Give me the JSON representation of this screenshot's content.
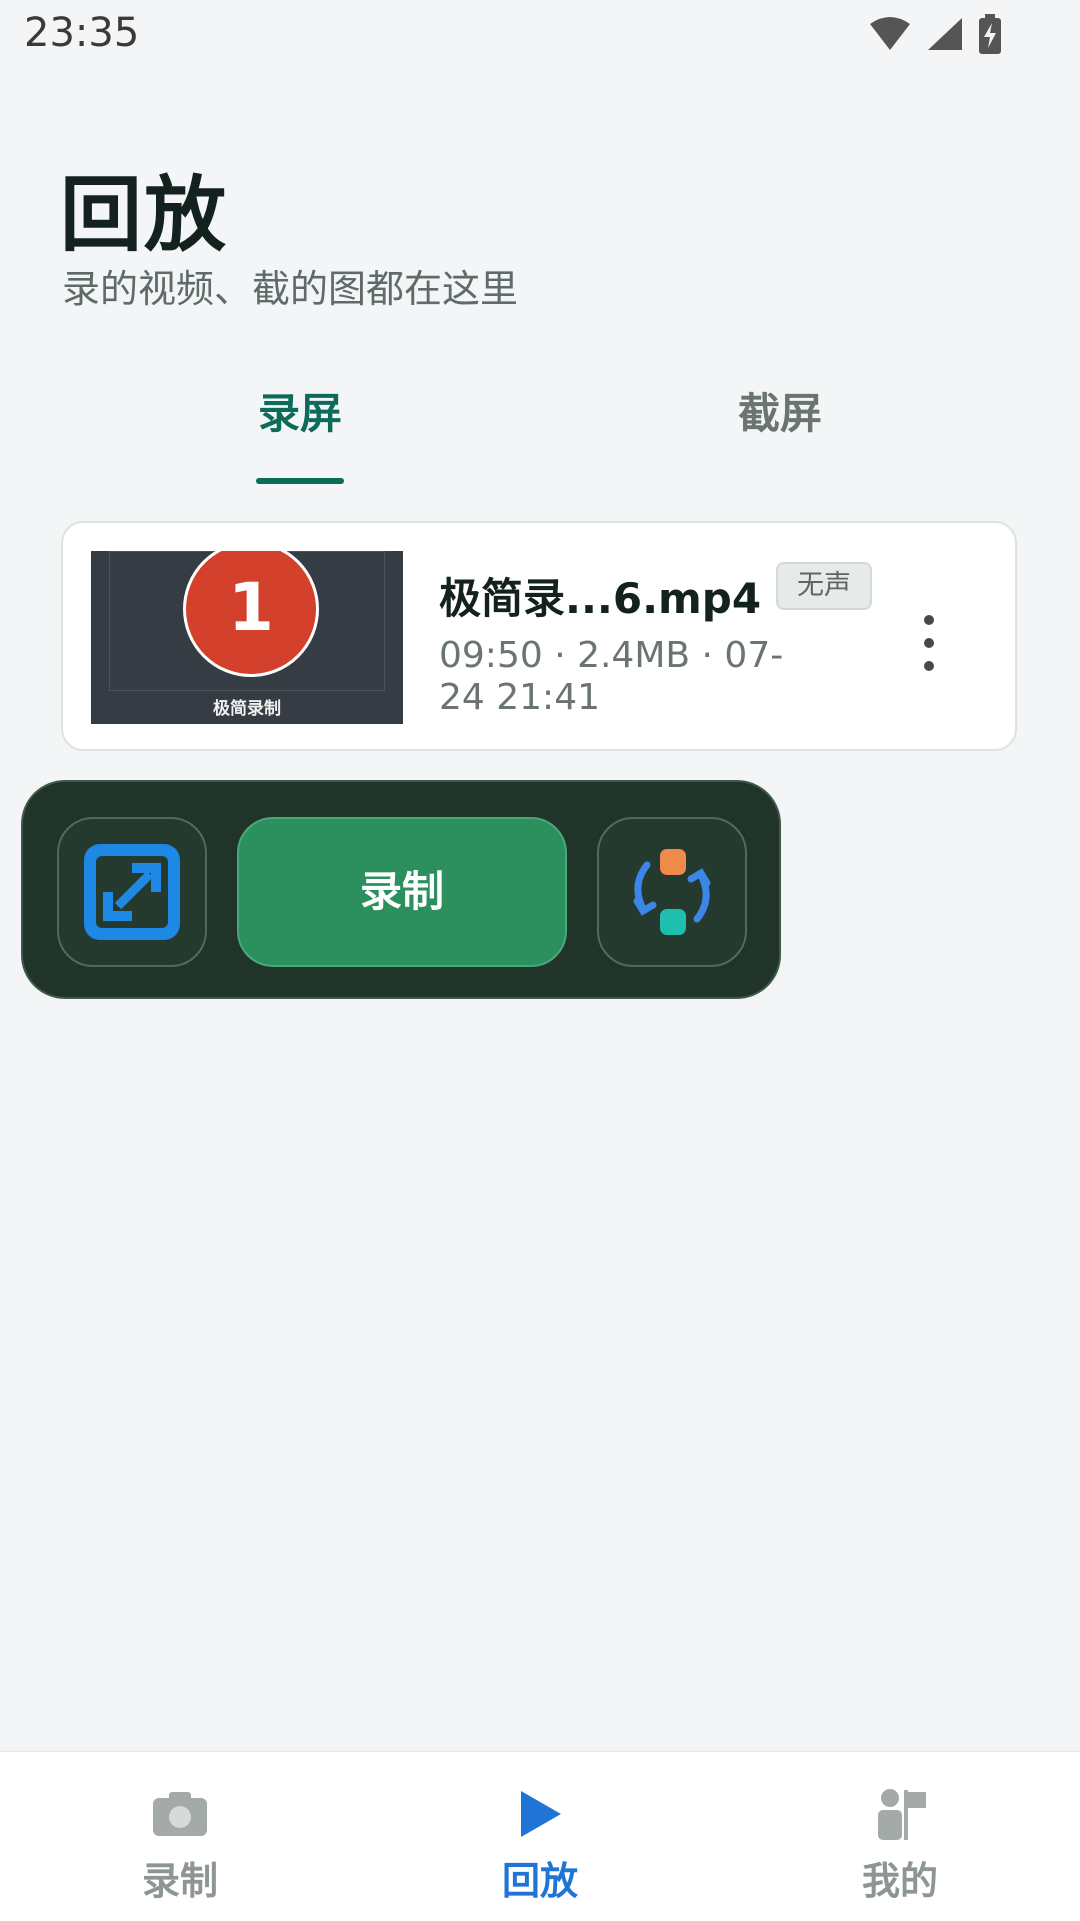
{
  "status_bar": {
    "time": "23:35"
  },
  "header": {
    "title": "回放",
    "subtitle": "录的视频、截的图都在这里"
  },
  "tabs": [
    {
      "label": "录屏",
      "selected": true
    },
    {
      "label": "截屏",
      "selected": false
    }
  ],
  "recordings": [
    {
      "thumbnail_number": "1",
      "thumbnail_caption": "极简录制",
      "name": "极简录...6.mp4",
      "badge": "无声",
      "meta": "09:50 · 2.4MB · 07-24 21:41"
    }
  ],
  "floating_toolbar": {
    "record_label": "录制",
    "region_icon": "expand-frame-icon",
    "switch_icon": "switch-mode-icon"
  },
  "bottom_nav": [
    {
      "label": "录制",
      "icon": "camera-icon",
      "selected": false
    },
    {
      "label": "回放",
      "icon": "play-icon",
      "selected": true
    },
    {
      "label": "我的",
      "icon": "person-flag-icon",
      "selected": false
    }
  ],
  "colors": {
    "accent": "#0d6b5a",
    "nav_selected": "#1f74d6",
    "record_button": "#2b8f5e",
    "toolbar_bg": "#21342a",
    "thumbnail_badge": "#d3402c"
  }
}
